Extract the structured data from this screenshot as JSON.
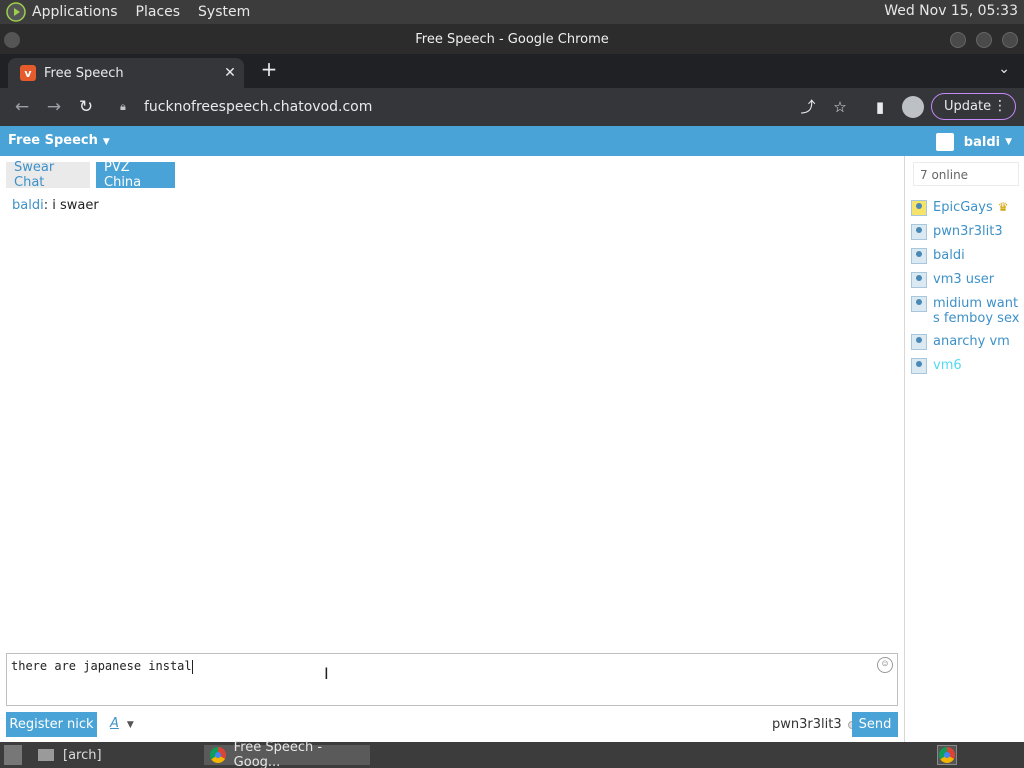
{
  "desktop": {
    "menus": [
      "Applications",
      "Places",
      "System"
    ],
    "clock": "Wed Nov 15, 05:33",
    "taskbar": {
      "folder_label": "[arch]",
      "chrome_label": "Free Speech - Goog..."
    }
  },
  "browser": {
    "window_title": "Free Speech - Google Chrome",
    "tab_title": "Free Speech",
    "url": "fucknofreespeech.chatovod.com",
    "update_label": "Update"
  },
  "chat": {
    "room_title": "Free Speech",
    "current_user": "baldi",
    "room_tabs": [
      {
        "label": "Swear Chat",
        "active": false
      },
      {
        "label": "PVZ China",
        "active": true
      }
    ],
    "messages": [
      {
        "nick": "baldi",
        "text": ": i swaer"
      }
    ],
    "input_value": "there are japanese instal",
    "register_label": "Register nick",
    "format_label": "A",
    "target_nick": "pwn3r3lit3",
    "send_label": "Send",
    "online_count": "7 online",
    "users": [
      {
        "name": "EpicGays",
        "badge": "crown",
        "style": "gold"
      },
      {
        "name": "pwn3r3lit3"
      },
      {
        "name": "baldi"
      },
      {
        "name": "vm3 user"
      },
      {
        "name": "midium want s femboy sex"
      },
      {
        "name": "anarchy vm"
      },
      {
        "name": "vm6",
        "style": "cyan"
      }
    ],
    "colors": {
      "accent": "#4aa3d6",
      "link": "#3d91c8",
      "cyan_user": "#53d9f0"
    }
  }
}
